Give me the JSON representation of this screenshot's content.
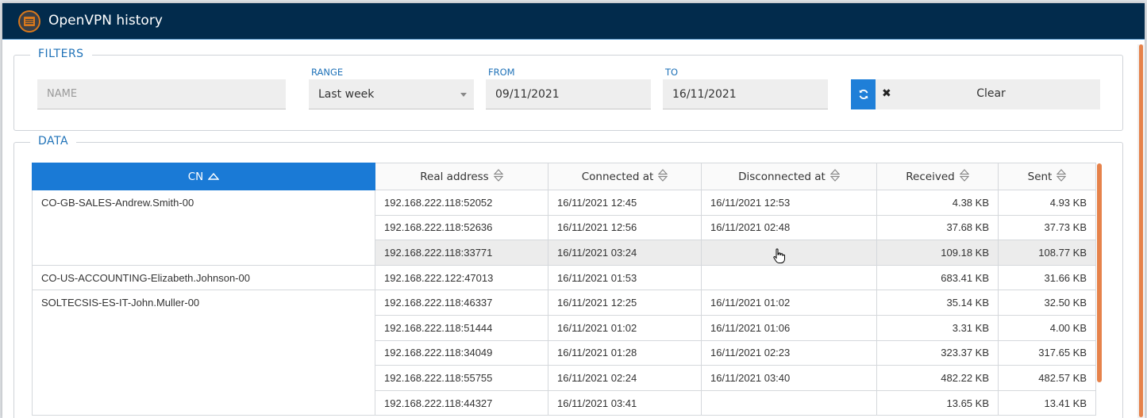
{
  "window": {
    "title": "OpenVPN history"
  },
  "filters": {
    "legend": "FILTERS",
    "name": {
      "placeholder": "NAME",
      "value": ""
    },
    "range": {
      "label": "RANGE",
      "value": "Last week"
    },
    "from": {
      "label": "FROM",
      "value": "09/11/2021"
    },
    "to": {
      "label": "TO",
      "value": "16/11/2021"
    },
    "clear_label": "Clear"
  },
  "data": {
    "legend": "DATA",
    "columns": [
      "CN",
      "Real address",
      "Connected at",
      "Disconnected at",
      "Received",
      "Sent"
    ],
    "sorted_column": "CN",
    "groups": [
      {
        "cn": "CO-GB-SALES-Andrew.Smith-00",
        "rows": [
          [
            "192.168.222.118:52052",
            "16/11/2021 12:45",
            "16/11/2021 12:53",
            "4.38 KB",
            "4.93 KB"
          ],
          [
            "192.168.222.118:52636",
            "16/11/2021 12:56",
            "16/11/2021 02:48",
            "37.68 KB",
            "37.73 KB"
          ],
          [
            "192.168.222.118:33771",
            "16/11/2021 03:24",
            "",
            "109.18 KB",
            "108.77 KB"
          ]
        ]
      },
      {
        "cn": "CO-US-ACCOUNTING-Elizabeth.Johnson-00",
        "rows": [
          [
            "192.168.222.122:47013",
            "16/11/2021 01:53",
            "",
            "683.41 KB",
            "31.66 KB"
          ]
        ]
      },
      {
        "cn": "SOLTECSIS-ES-IT-John.Muller-00",
        "rows": [
          [
            "192.168.222.118:46337",
            "16/11/2021 12:25",
            "16/11/2021 01:02",
            "35.14 KB",
            "32.50 KB"
          ],
          [
            "192.168.222.118:51444",
            "16/11/2021 01:02",
            "16/11/2021 01:06",
            "3.31 KB",
            "4.00 KB"
          ],
          [
            "192.168.222.118:34049",
            "16/11/2021 01:28",
            "16/11/2021 02:23",
            "323.37 KB",
            "317.65 KB"
          ],
          [
            "192.168.222.118:55755",
            "16/11/2021 02:24",
            "16/11/2021 03:40",
            "482.22 KB",
            "482.57 KB"
          ],
          [
            "192.168.222.118:44327",
            "16/11/2021 03:41",
            "",
            "13.65 KB",
            "13.41 KB"
          ]
        ]
      }
    ],
    "highlighted_row": "192.168.222.118:33771"
  },
  "colors": {
    "titlebar": "#022b4c",
    "accent": "#1a7ad6",
    "legend_text": "#1f72b8",
    "scrollbar": "#e6824a"
  },
  "icons": {
    "app": "list-icon",
    "refresh": "refresh-icon",
    "clear": "close-icon",
    "sort": "sort-icon",
    "cursor": "hand-cursor-icon"
  }
}
